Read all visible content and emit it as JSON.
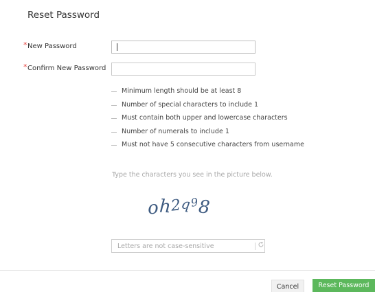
{
  "dialog": {
    "title": "Reset Password"
  },
  "form": {
    "new_password_label": "New Password",
    "new_password_value": "",
    "confirm_password_label": "Confirm New Password",
    "confirm_password_value": "",
    "required_marker": "*"
  },
  "rules": [
    "Minimum length should be at least 8",
    "Number of special characters to include 1",
    "Must contain both upper and lowercase characters",
    "Number of numerals to include 1",
    "Must not have 5 consecutive characters from username"
  ],
  "captcha": {
    "hint": "Type the characters you see in the picture below.",
    "chars": [
      "o",
      "h",
      "2",
      "q",
      "9",
      "8"
    ],
    "placeholder": "Letters are not case-sensitive",
    "refresh_icon": "refresh-icon"
  },
  "buttons": {
    "cancel_label": "Cancel",
    "reset_label": "Reset Password"
  },
  "colors": {
    "primary_button": "#5cb85c",
    "required": "#e53935",
    "captcha_text": "#3d5a80"
  }
}
